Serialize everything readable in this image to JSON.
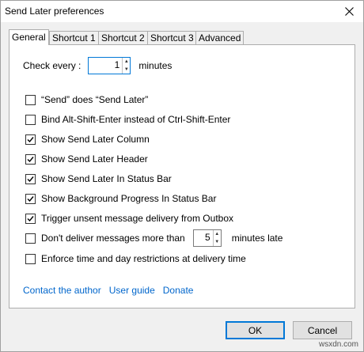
{
  "window": {
    "title": "Send Later preferences"
  },
  "tabs": [
    {
      "label": "General"
    },
    {
      "label": "Shortcut 1"
    },
    {
      "label": "Shortcut 2"
    },
    {
      "label": "Shortcut 3"
    },
    {
      "label": "Advanced"
    }
  ],
  "general": {
    "check_every_label": "Check every :",
    "check_every_value": "1",
    "check_every_unit": "minutes",
    "options": [
      {
        "label": "“Send” does “Send Later”",
        "checked": false
      },
      {
        "label": "Bind Alt-Shift-Enter instead of Ctrl-Shift-Enter",
        "checked": false
      },
      {
        "label": "Show Send Later Column",
        "checked": true
      },
      {
        "label": "Show Send Later Header",
        "checked": true
      },
      {
        "label": "Show Send Later In Status Bar",
        "checked": true
      },
      {
        "label": "Show Background Progress In Status Bar",
        "checked": true
      },
      {
        "label": "Trigger unsent message delivery from Outbox",
        "checked": true
      }
    ],
    "dont_deliver": {
      "label_before": "Don't deliver messages more than",
      "value": "5",
      "label_after": "minutes late",
      "checked": false
    },
    "enforce": {
      "label": "Enforce time and day restrictions at delivery time",
      "checked": false
    },
    "links": {
      "contact": "Contact the author",
      "guide": "User guide",
      "donate": "Donate"
    }
  },
  "buttons": {
    "ok": "OK",
    "cancel": "Cancel"
  },
  "watermark": "wsxdn.com"
}
